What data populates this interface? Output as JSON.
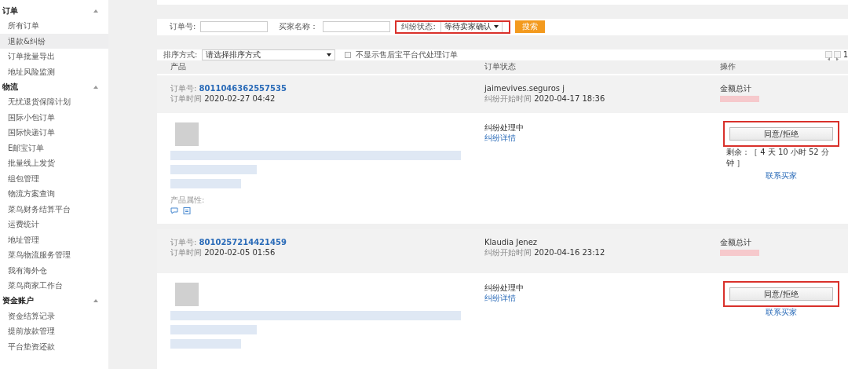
{
  "sidebar": {
    "groups": [
      {
        "title": "订单",
        "expanded": true,
        "items": [
          {
            "label": "所有订单",
            "selected": false
          },
          {
            "label": "退款&纠纷",
            "selected": true
          },
          {
            "label": "订单批量导出",
            "selected": false
          },
          {
            "label": "地址风险监测",
            "selected": false
          }
        ]
      },
      {
        "title": "物流",
        "expanded": true,
        "items": [
          {
            "label": "无忧退货保障计划",
            "selected": false
          },
          {
            "label": "国际小包订单",
            "selected": false
          },
          {
            "label": "国际快递订单",
            "selected": false
          },
          {
            "label": "E邮宝订单",
            "selected": false
          },
          {
            "label": "批量线上发货",
            "selected": false
          },
          {
            "label": "组包管理",
            "selected": false
          },
          {
            "label": "物流方案查询",
            "selected": false
          },
          {
            "label": "菜鸟财务结算平台",
            "selected": false
          },
          {
            "label": "运费统计",
            "selected": false
          },
          {
            "label": "地址管理",
            "selected": false
          },
          {
            "label": "菜鸟物流服务管理",
            "selected": false
          },
          {
            "label": "我有海外仓",
            "selected": false
          },
          {
            "label": "菜鸟商家工作台",
            "selected": false
          }
        ]
      },
      {
        "title": "资金账户",
        "expanded": true,
        "items": [
          {
            "label": "资金结算记录",
            "selected": false
          },
          {
            "label": "提前放款管理",
            "selected": false
          },
          {
            "label": "平台垫资还款",
            "selected": false
          }
        ]
      }
    ]
  },
  "filters": {
    "order_no": {
      "label": "订单号:"
    },
    "buyer_name": {
      "label": "买家名称："
    },
    "dispute_status": {
      "label": "纠纷状态:",
      "value": "等待卖家确认",
      "highlighted": true
    },
    "search_button": "搜索"
  },
  "sort": {
    "label": "排序方式:",
    "value": "请选择排序方式",
    "hide_platform": {
      "label": "不显示售后宝平台代处理订单",
      "checked": false
    }
  },
  "pagination": {
    "page": "1"
  },
  "table": {
    "columns": [
      "产品",
      "订单状态",
      "操作"
    ]
  },
  "orders": [
    {
      "order_no_label": "订单号:",
      "order_no": "8011046362557535",
      "time_label": "订单时间",
      "time": "2020-02-27 04:42",
      "buyer": "jaimevives.seguros j",
      "dispute_time_label": "纠纷开始时间",
      "dispute_time": "2020-04-17 18:36",
      "amount_label": "金额总计",
      "product_attr_label": "产品属性:",
      "status": "纠纷处理中",
      "detail_link": "纠纷详情",
      "action_button": {
        "label": "同意/拒绝",
        "highlighted": true
      },
      "remaining": "剩余：［ 4 天 10 小时 52 分钟 ］",
      "contact_link": "联系买家"
    },
    {
      "order_no_label": "订单号:",
      "order_no": "8010257214421459",
      "time_label": "订单时间",
      "time": "2020-02-05 01:56",
      "buyer": "Klaudia Jenez",
      "dispute_time_label": "纠纷开始时间",
      "dispute_time": "2020-04-16 23:12",
      "amount_label": "金额总计",
      "status": "纠纷处理中",
      "detail_link": "纠纷详情",
      "action_button": {
        "label": "同意/拒绝",
        "highlighted": true
      },
      "contact_link": "联系买家"
    }
  ]
}
